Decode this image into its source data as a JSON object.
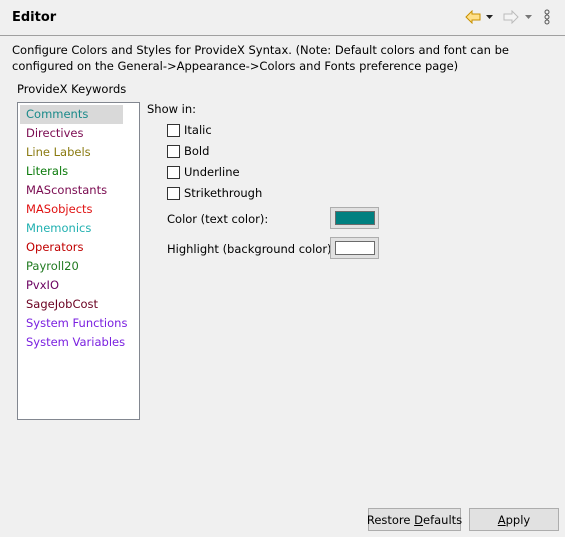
{
  "header": {
    "title": "Editor",
    "back_icon": "back-arrow-icon",
    "forward_icon": "forward-arrow-icon",
    "menu_icon": "view-menu-icon"
  },
  "description": "Configure Colors and Styles for ProvideX Syntax. (Note: Default colors and font can be configured on the General->Appearance->Colors and Fonts preference page)",
  "keywords": {
    "label": "ProvideX Keywords",
    "selected": "Comments",
    "items": [
      {
        "label": "Comments",
        "color": "#1a8a8a"
      },
      {
        "label": "Directives",
        "color": "#7a0a50"
      },
      {
        "label": "Line Labels",
        "color": "#8a7a10"
      },
      {
        "label": "Literals",
        "color": "#0a7a0a"
      },
      {
        "label": "MASconstants",
        "color": "#7a0a50"
      },
      {
        "label": "MASobjects",
        "color": "#e01010"
      },
      {
        "label": "Mnemonics",
        "color": "#20b0b0"
      },
      {
        "label": "Operators",
        "color": "#c00000"
      },
      {
        "label": "Payroll20",
        "color": "#207a20"
      },
      {
        "label": "PvxIO",
        "color": "#6a0060"
      },
      {
        "label": "SageJobCost",
        "color": "#6a0020"
      },
      {
        "label": "System Functions",
        "color": "#7a20e0"
      },
      {
        "label": "System Variables",
        "color": "#7a20e0"
      }
    ]
  },
  "style": {
    "show_in_label": "Show in:",
    "options": [
      {
        "label": "Italic",
        "checked": false
      },
      {
        "label": "Bold",
        "checked": false
      },
      {
        "label": "Underline",
        "checked": false
      },
      {
        "label": "Strikethrough",
        "checked": false
      }
    ],
    "color_label": "Color (text color):",
    "color_value": "#008080",
    "highlight_label": "Highlight (background color):",
    "highlight_value": "#ffffff"
  },
  "buttons": {
    "restore_pre": "Restore ",
    "restore_mn": "D",
    "restore_post": "efaults",
    "apply_mn": "A",
    "apply_post": "pply"
  }
}
